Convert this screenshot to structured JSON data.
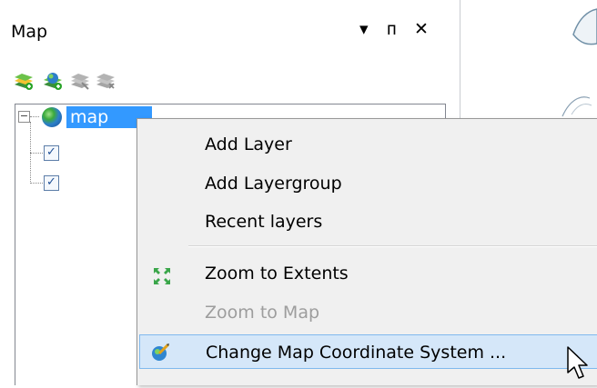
{
  "panel": {
    "title": "Map",
    "controls": {
      "dropdown": "▾",
      "pin": "ᴨ",
      "close": "✕"
    },
    "toolbar": [
      {
        "name": "add-layer",
        "enabled": true
      },
      {
        "name": "add-layer-group",
        "enabled": true
      },
      {
        "name": "remove-layer",
        "enabled": false
      },
      {
        "name": "layer-properties",
        "enabled": false
      }
    ]
  },
  "tree": {
    "root_label": "map",
    "children": [
      {
        "checked": true
      },
      {
        "checked": true
      }
    ]
  },
  "context_menu": {
    "items": [
      {
        "label": "Add Layer",
        "enabled": true
      },
      {
        "label": "Add Layergroup",
        "enabled": true
      },
      {
        "label": "Recent layers",
        "enabled": true
      },
      {
        "label": "Zoom to Extents",
        "enabled": true,
        "icon": "zoom-extents-icon"
      },
      {
        "label": "Zoom to Map",
        "enabled": false
      },
      {
        "label": "Change Map Coordinate System ...",
        "enabled": true,
        "icon": "coordinate-system-icon",
        "highlighted": true
      }
    ]
  },
  "colors": {
    "selection": "#3399ff",
    "menu_highlight": "#d5e7f9",
    "menu_bg": "#f0f0f0"
  }
}
